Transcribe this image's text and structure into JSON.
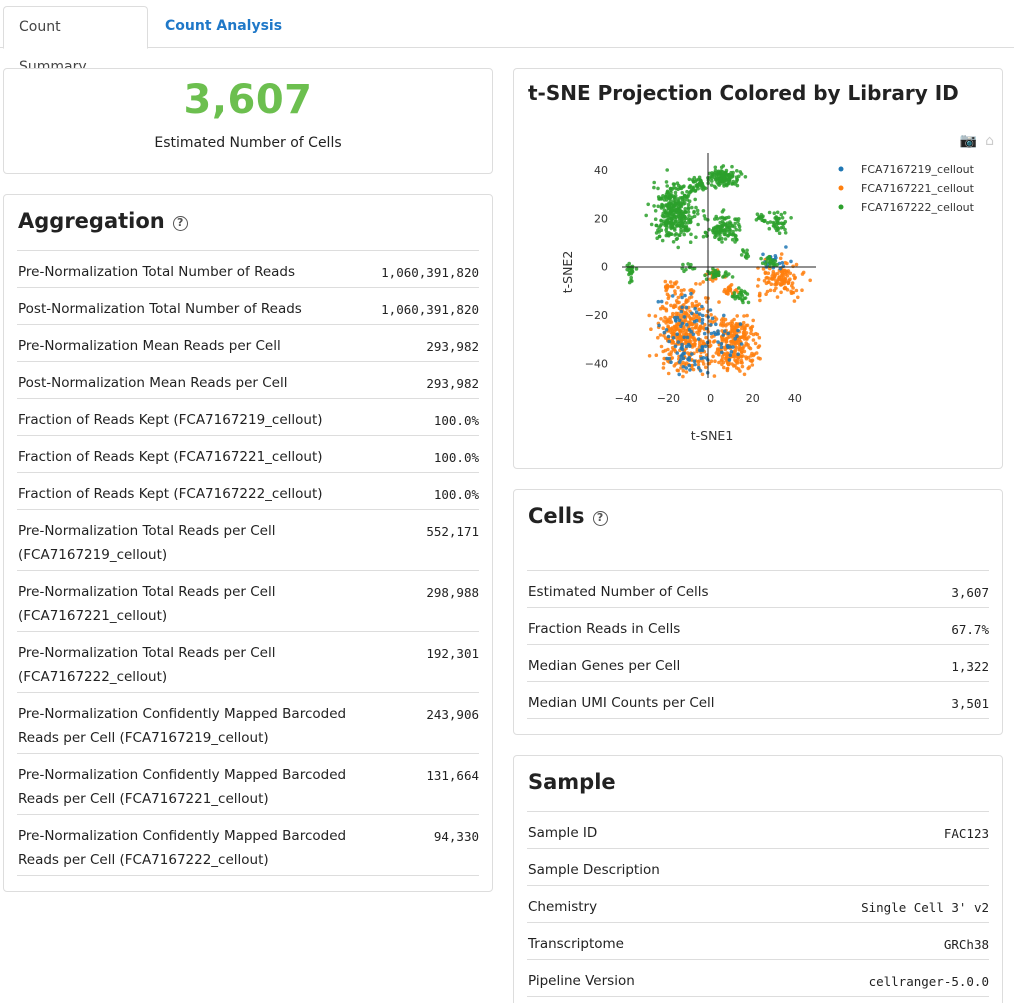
{
  "tabs": {
    "summary": "Count Summary",
    "analysis": "Count Analysis"
  },
  "hero": {
    "value": "3,607",
    "label": "Estimated Number of Cells"
  },
  "aggregation": {
    "title": "Aggregation",
    "rows": [
      {
        "label": "Pre-Normalization Total Number of Reads",
        "value": "1,060,391,820"
      },
      {
        "label": "Post-Normalization Total Number of Reads",
        "value": "1,060,391,820"
      },
      {
        "label": "Pre-Normalization Mean Reads per Cell",
        "value": "293,982"
      },
      {
        "label": "Post-Normalization Mean Reads per Cell",
        "value": "293,982"
      },
      {
        "label": "Fraction of Reads Kept (FCA7167219_cellout)",
        "value": "100.0%"
      },
      {
        "label": "Fraction of Reads Kept (FCA7167221_cellout)",
        "value": "100.0%"
      },
      {
        "label": "Fraction of Reads Kept (FCA7167222_cellout)",
        "value": "100.0%"
      },
      {
        "label": "Pre-Normalization Total Reads per Cell (FCA7167219_cellout)",
        "value": "552,171"
      },
      {
        "label": "Pre-Normalization Total Reads per Cell (FCA7167221_cellout)",
        "value": "298,988"
      },
      {
        "label": "Pre-Normalization Total Reads per Cell (FCA7167222_cellout)",
        "value": "192,301"
      },
      {
        "label": "Pre-Normalization Confidently Mapped Barcoded Reads per Cell (FCA7167219_cellout)",
        "value": "243,906"
      },
      {
        "label": "Pre-Normalization Confidently Mapped Barcoded Reads per Cell (FCA7167221_cellout)",
        "value": "131,664"
      },
      {
        "label": "Pre-Normalization Confidently Mapped Barcoded Reads per Cell (FCA7167222_cellout)",
        "value": "94,330"
      }
    ]
  },
  "cells": {
    "title": "Cells",
    "rows": [
      {
        "label": "Estimated Number of Cells",
        "value": "3,607"
      },
      {
        "label": "Fraction Reads in Cells",
        "value": "67.7%"
      },
      {
        "label": "Median Genes per Cell",
        "value": "1,322"
      },
      {
        "label": "Median UMI Counts per Cell",
        "value": "3,501"
      }
    ]
  },
  "sample": {
    "title": "Sample",
    "rows": [
      {
        "label": "Sample ID",
        "value": "FAC123"
      },
      {
        "label": "Sample Description",
        "value": ""
      },
      {
        "label": "Chemistry",
        "value": "Single Cell 3' v2"
      },
      {
        "label": "Transcriptome",
        "value": "GRCh38"
      },
      {
        "label": "Pipeline Version",
        "value": "cellranger-5.0.0"
      }
    ]
  },
  "icons": {
    "help": "help-circle-icon",
    "camera": "camera-icon",
    "home": "home-icon"
  },
  "chart_data": {
    "type": "scatter",
    "title": "t-SNE Projection Colored by Library ID",
    "xlabel": "t-SNE1",
    "ylabel": "t-SNE2",
    "xlim": [
      -42,
      50
    ],
    "ylim": [
      -46,
      47
    ],
    "xticks": [
      "−40",
      "−20",
      "0",
      "20",
      "40"
    ],
    "xtick_values": [
      -40,
      -20,
      0,
      20,
      40
    ],
    "yticks": [
      "40",
      "20",
      "0",
      "−20",
      "−40"
    ],
    "ytick_values": [
      40,
      20,
      0,
      -20,
      -40
    ],
    "legend_position": "top-right",
    "series": [
      {
        "name": "FCA7167219_cellout",
        "color": "#1f77b4",
        "clusters": [
          {
            "x": -10,
            "y": -28,
            "rx": 12,
            "ry": 16,
            "n": 90
          },
          {
            "x": 30,
            "y": 2,
            "rx": 12,
            "ry": 5,
            "n": 20
          },
          {
            "x": 5,
            "y": -30,
            "rx": 10,
            "ry": 10,
            "n": 30
          }
        ]
      },
      {
        "name": "FCA7167221_cellout",
        "color": "#ff7f0e",
        "clusters": [
          {
            "x": -12,
            "y": -28,
            "rx": 13,
            "ry": 17,
            "n": 380
          },
          {
            "x": 12,
            "y": -32,
            "rx": 10,
            "ry": 12,
            "n": 260
          },
          {
            "x": 33,
            "y": -5,
            "rx": 11,
            "ry": 7,
            "n": 120
          },
          {
            "x": 9,
            "y": -10,
            "rx": 4,
            "ry": 3,
            "n": 25
          },
          {
            "x": 2,
            "y": -4,
            "rx": 5,
            "ry": 3,
            "n": 20
          },
          {
            "x": -18,
            "y": -8,
            "rx": 3,
            "ry": 2,
            "n": 15
          }
        ]
      },
      {
        "name": "FCA7167222_cellout",
        "color": "#2ca02c",
        "clusters": [
          {
            "x": -17,
            "y": 23,
            "rx": 10,
            "ry": 12,
            "n": 320
          },
          {
            "x": 6,
            "y": 37,
            "rx": 8,
            "ry": 4,
            "n": 120
          },
          {
            "x": -6,
            "y": 34,
            "rx": 4,
            "ry": 3,
            "n": 40
          },
          {
            "x": 6,
            "y": 16,
            "rx": 8,
            "ry": 6,
            "n": 110
          },
          {
            "x": 32,
            "y": 18,
            "rx": 5,
            "ry": 4,
            "n": 40
          },
          {
            "x": 24,
            "y": 20,
            "rx": 2,
            "ry": 2,
            "n": 15
          },
          {
            "x": -38,
            "y": -2,
            "rx": 2,
            "ry": 4,
            "n": 25
          },
          {
            "x": 3,
            "y": -3,
            "rx": 5,
            "ry": 2,
            "n": 30
          },
          {
            "x": 14,
            "y": -12,
            "rx": 4,
            "ry": 3,
            "n": 25
          },
          {
            "x": 28,
            "y": 2,
            "rx": 4,
            "ry": 3,
            "n": 20
          },
          {
            "x": 17,
            "y": 5,
            "rx": 2,
            "ry": 2,
            "n": 10
          },
          {
            "x": -10,
            "y": 0,
            "rx": 3,
            "ry": 2,
            "n": 10
          }
        ]
      }
    ]
  }
}
